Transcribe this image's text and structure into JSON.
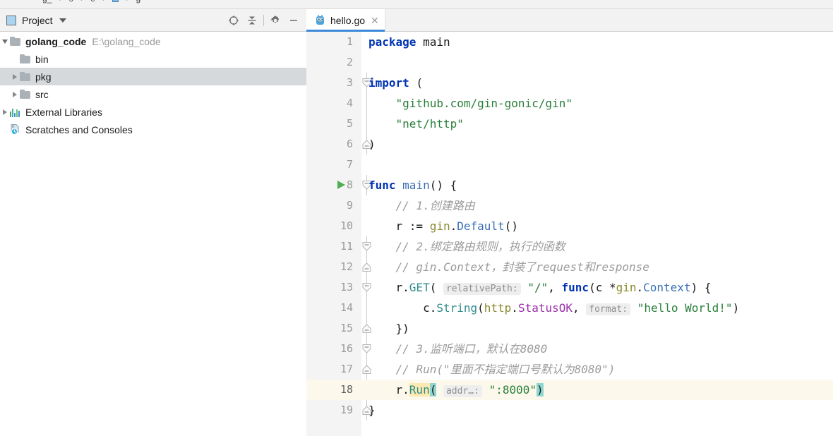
{
  "window": {
    "breadcrumb": [
      "g_",
      "s",
      "e",
      "",
      "g"
    ]
  },
  "project_pane": {
    "title": "Project",
    "icon": "project-window-icon",
    "dropdown_icon": "chevron-down-icon",
    "actions": [
      {
        "name": "locate-file-icon",
        "title": "Select Opened File"
      },
      {
        "name": "collapse-all-icon",
        "title": "Collapse All"
      },
      {
        "name": "gear-icon",
        "title": "Settings"
      },
      {
        "name": "minimize-icon",
        "title": "Hide"
      }
    ],
    "tree": [
      {
        "label": "golang_code",
        "path": "E:\\golang_code",
        "icon": "folder-icon",
        "arrow": "down",
        "bold": true,
        "indent": 0,
        "selected": false
      },
      {
        "label": "bin",
        "path": "",
        "icon": "folder-icon",
        "arrow": "none",
        "bold": false,
        "indent": 1,
        "selected": false
      },
      {
        "label": "pkg",
        "path": "",
        "icon": "folder-icon",
        "arrow": "right",
        "bold": false,
        "indent": 1,
        "selected": true
      },
      {
        "label": "src",
        "path": "",
        "icon": "folder-icon",
        "arrow": "right",
        "bold": false,
        "indent": 1,
        "selected": false
      },
      {
        "label": "External Libraries",
        "path": "",
        "icon": "library-icon",
        "arrow": "right",
        "bold": false,
        "indent": 0,
        "selected": false
      },
      {
        "label": "Scratches and Consoles",
        "path": "",
        "icon": "scratches-icon",
        "arrow": "none",
        "bold": false,
        "indent": 0,
        "selected": false
      }
    ]
  },
  "editor": {
    "tabs": [
      {
        "label": "hello.go",
        "icon": "go-file-icon",
        "close_icon": "close-icon",
        "active": true
      }
    ],
    "active_line": 18,
    "run_marker_line": 8,
    "lines": [
      {
        "n": 1,
        "fold": "none",
        "tokens": [
          {
            "t": "package",
            "c": "kw"
          },
          {
            "t": " ",
            "c": "pun"
          },
          {
            "t": "main",
            "c": "pun"
          }
        ]
      },
      {
        "n": 2,
        "fold": "none",
        "tokens": []
      },
      {
        "n": 3,
        "fold": "start",
        "tokens": [
          {
            "t": "import",
            "c": "kw"
          },
          {
            "t": " (",
            "c": "pun"
          }
        ]
      },
      {
        "n": 4,
        "fold": "line",
        "tokens": [
          {
            "t": "    ",
            "c": "pun"
          },
          {
            "t": "\"github.com/gin-gonic/gin\"",
            "c": "str"
          }
        ]
      },
      {
        "n": 5,
        "fold": "line",
        "tokens": [
          {
            "t": "    ",
            "c": "pun"
          },
          {
            "t": "\"net/http\"",
            "c": "str"
          }
        ]
      },
      {
        "n": 6,
        "fold": "end",
        "tokens": [
          {
            "t": ")",
            "c": "pun"
          }
        ]
      },
      {
        "n": 7,
        "fold": "none",
        "tokens": []
      },
      {
        "n": 8,
        "fold": "start",
        "tokens": [
          {
            "t": "func",
            "c": "kw"
          },
          {
            "t": " ",
            "c": "pun"
          },
          {
            "t": "main",
            "c": "fn"
          },
          {
            "t": "() {",
            "c": "pun"
          }
        ]
      },
      {
        "n": 9,
        "fold": "none",
        "tokens": [
          {
            "t": "    // 1.创建路由",
            "c": "cmt"
          }
        ]
      },
      {
        "n": 10,
        "fold": "none",
        "tokens": [
          {
            "t": "    r := ",
            "c": "pun"
          },
          {
            "t": "gin",
            "c": "pkgn"
          },
          {
            "t": ".",
            "c": "pun"
          },
          {
            "t": "Default",
            "c": "fn"
          },
          {
            "t": "()",
            "c": "pun"
          }
        ]
      },
      {
        "n": 11,
        "fold": "start",
        "tokens": [
          {
            "t": "    // 2.绑定路由规则，执行的函数",
            "c": "cmt"
          }
        ]
      },
      {
        "n": 12,
        "fold": "end",
        "tokens": [
          {
            "t": "    // gin.Context，封装了request和response",
            "c": "cmt"
          }
        ]
      },
      {
        "n": 13,
        "fold": "start",
        "tokens": [
          {
            "t": "    r.",
            "c": "pun"
          },
          {
            "t": "GET",
            "c": "mth"
          },
          {
            "t": "( ",
            "c": "pun"
          },
          {
            "t": "relativePath:",
            "c": "hint"
          },
          {
            "t": " ",
            "c": "pun"
          },
          {
            "t": "\"/\"",
            "c": "str"
          },
          {
            "t": ", ",
            "c": "pun"
          },
          {
            "t": "func",
            "c": "kw"
          },
          {
            "t": "(c *",
            "c": "pun"
          },
          {
            "t": "gin",
            "c": "pkgn"
          },
          {
            "t": ".",
            "c": "pun"
          },
          {
            "t": "Context",
            "c": "fn"
          },
          {
            "t": ") {",
            "c": "pun"
          }
        ]
      },
      {
        "n": 14,
        "fold": "line",
        "tokens": [
          {
            "t": "        c.",
            "c": "pun"
          },
          {
            "t": "String",
            "c": "mth"
          },
          {
            "t": "(",
            "c": "pun"
          },
          {
            "t": "http",
            "c": "pkgn"
          },
          {
            "t": ".",
            "c": "pun"
          },
          {
            "t": "StatusOK",
            "c": "cst"
          },
          {
            "t": ", ",
            "c": "pun"
          },
          {
            "t": "format:",
            "c": "hint"
          },
          {
            "t": " ",
            "c": "pun"
          },
          {
            "t": "\"hello World!\"",
            "c": "str"
          },
          {
            "t": ")",
            "c": "pun"
          }
        ]
      },
      {
        "n": 15,
        "fold": "end",
        "tokens": [
          {
            "t": "    })",
            "c": "pun"
          }
        ]
      },
      {
        "n": 16,
        "fold": "start",
        "tokens": [
          {
            "t": "    // 3.监听端口，默认在8080",
            "c": "cmt"
          }
        ]
      },
      {
        "n": 17,
        "fold": "end",
        "tokens": [
          {
            "t": "    // Run(\"里面不指定端口号默认为8080\")",
            "c": "cmt"
          }
        ]
      },
      {
        "n": 18,
        "fold": "none",
        "tokens": [
          {
            "t": "    r.",
            "c": "pun"
          },
          {
            "t": "Run",
            "c": "mth hl-ident"
          },
          {
            "t": "(",
            "c": "pun hl-brace"
          },
          {
            "t": " ",
            "c": "pun"
          },
          {
            "t": "addr…:",
            "c": "hint"
          },
          {
            "t": " ",
            "c": "pun"
          },
          {
            "t": "\":8000\"",
            "c": "str"
          },
          {
            "t": ")",
            "c": "pun hl-brace"
          }
        ]
      },
      {
        "n": 19,
        "fold": "end",
        "tokens": [
          {
            "t": "}",
            "c": "pun"
          }
        ]
      }
    ]
  },
  "colors": {
    "accent": "#3d88d8",
    "keyword": "#0033b3",
    "string": "#287e39",
    "comment": "#9b9b9b",
    "package": "#8a8a2e",
    "constant": "#9a30a8",
    "caret_line": "#fcf9ec",
    "selection": "#d6d9dc"
  }
}
